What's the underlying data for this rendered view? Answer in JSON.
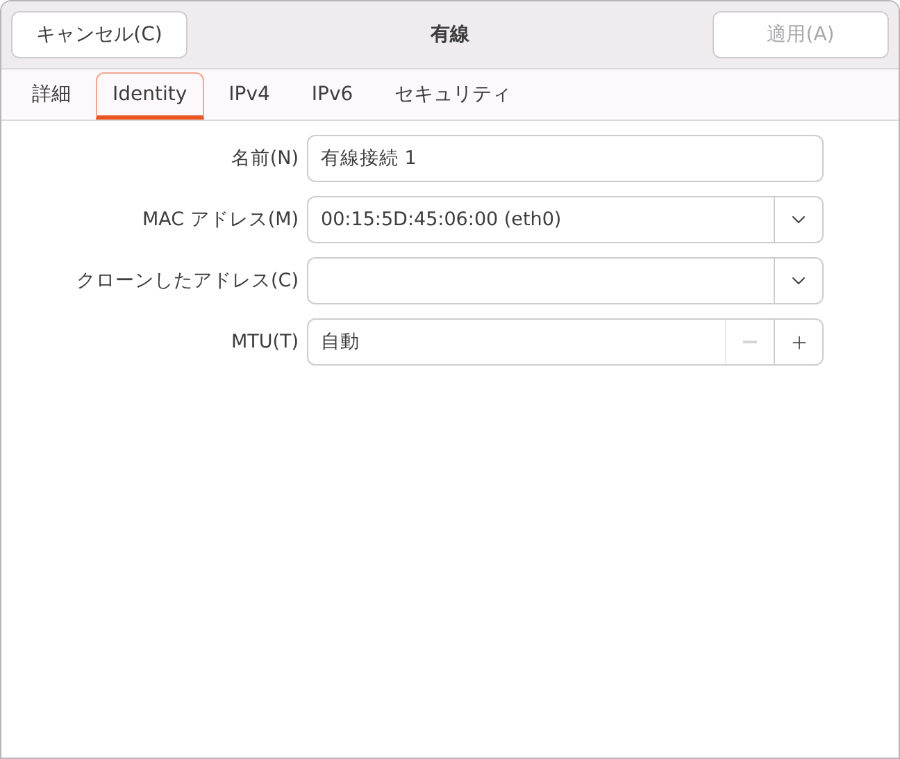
{
  "header": {
    "cancel": {
      "label": "キャンセル(C)",
      "disabled": false
    },
    "title": "有線",
    "apply": {
      "label": "適用(A)",
      "disabled": true
    }
  },
  "tabs": [
    {
      "label": "詳細",
      "selected": false
    },
    {
      "label": "Identity",
      "selected": true
    },
    {
      "label": "IPv4",
      "selected": false
    },
    {
      "label": "IPv6",
      "selected": false
    },
    {
      "label": "セキュリティ",
      "selected": false
    }
  ],
  "fields": [
    {
      "kind": "text",
      "label": "名前(N)",
      "value": "有線接続 1"
    },
    {
      "kind": "combo",
      "label": "MAC アドレス(M)",
      "value": "00:15:5D:45:06:00 (eth0)"
    },
    {
      "kind": "combo",
      "label": "クローンしたアドレス(C)"
    },
    {
      "kind": "spin",
      "label": "MTU(T)",
      "value": "自動",
      "minus_disabled": true,
      "plus_disabled": false
    }
  ]
}
